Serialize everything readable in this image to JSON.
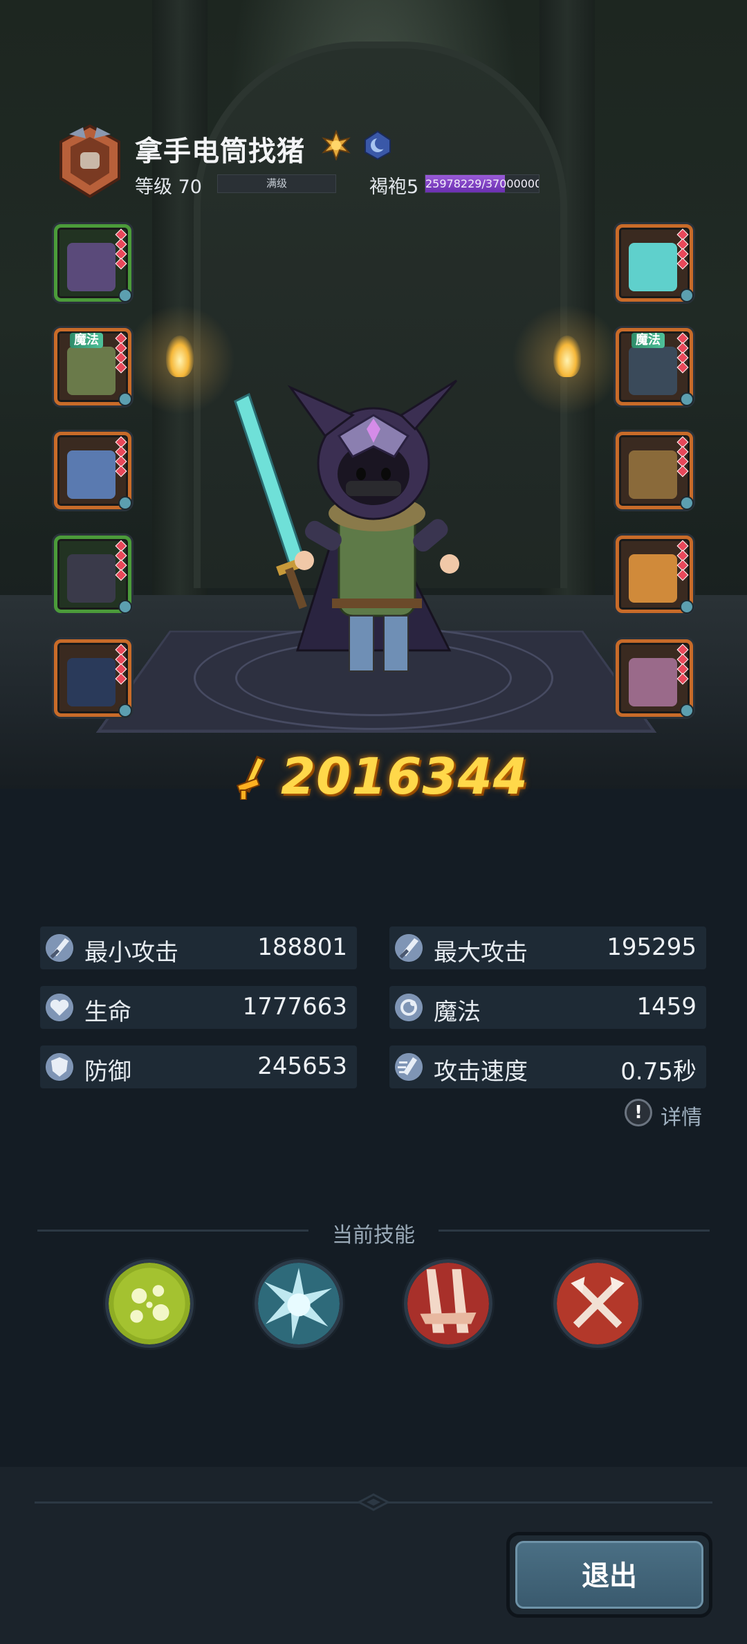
{
  "header": {
    "player_name": "拿手电筒找猪",
    "level_label": "等级 70",
    "level_bar_text": "满级",
    "rank_label": "褐袍5",
    "rank_progress_text": "25978229/37000000",
    "rank_progress": 0.702
  },
  "equipment": {
    "left": [
      {
        "name": "helmet",
        "rarity": "green",
        "tag": ""
      },
      {
        "name": "armor",
        "rarity": "orange",
        "tag": "魔法"
      },
      {
        "name": "boots",
        "rarity": "orange",
        "tag": ""
      },
      {
        "name": "bracer",
        "rarity": "green",
        "tag": ""
      },
      {
        "name": "pants",
        "rarity": "orange",
        "tag": ""
      }
    ],
    "right": [
      {
        "name": "sword",
        "rarity": "orange",
        "tag": ""
      },
      {
        "name": "ring",
        "rarity": "orange",
        "tag": "魔法"
      },
      {
        "name": "necklace",
        "rarity": "orange",
        "tag": ""
      },
      {
        "name": "talisman",
        "rarity": "orange",
        "tag": ""
      },
      {
        "name": "pet",
        "rarity": "orange",
        "tag": ""
      }
    ]
  },
  "power": "2016344",
  "stats": [
    {
      "label": "最小攻击",
      "value": "188801",
      "icon": "sword-icon"
    },
    {
      "label": "最大攻击",
      "value": "195295",
      "icon": "sword-icon"
    },
    {
      "label": "生命",
      "value": "1777663",
      "icon": "heart-icon"
    },
    {
      "label": "魔法",
      "value": "1459",
      "icon": "magic-icon"
    },
    {
      "label": "防御",
      "value": "245653",
      "icon": "shield-icon"
    },
    {
      "label": "攻击速度",
      "value": "0.75秒",
      "icon": "speed-icon"
    }
  ],
  "details_label": "详情",
  "skills_title": "当前技能",
  "skills": [
    {
      "name": "bubbles-skill-icon",
      "color": "#9ab82a"
    },
    {
      "name": "burst-skill-icon",
      "color": "#5aa8b8"
    },
    {
      "name": "slash-skill-icon",
      "color": "#b8342a"
    },
    {
      "name": "crossed-axes-skill-icon",
      "color": "#b83a2a"
    }
  ],
  "exit_label": "退出"
}
